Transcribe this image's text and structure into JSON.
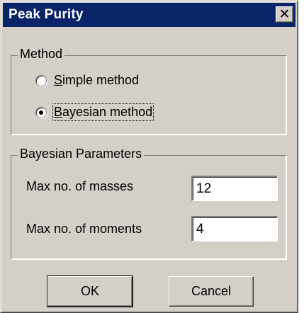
{
  "window": {
    "title": "Peak Purity",
    "close_icon": "close-icon",
    "close_glyph": "✕"
  },
  "method_group": {
    "label": "Method",
    "options": [
      {
        "label": "Simple method",
        "selected": false,
        "mnemonic": "S"
      },
      {
        "label": "Bayesian method",
        "selected": true,
        "mnemonic": "B"
      }
    ]
  },
  "bayesian_group": {
    "label": "Bayesian Parameters",
    "max_masses_label": "Max no. of masses",
    "max_masses_value": "12",
    "max_moments_label": "Max no. of moments",
    "max_moments_value": "4"
  },
  "buttons": {
    "ok": "OK",
    "cancel": "Cancel"
  }
}
